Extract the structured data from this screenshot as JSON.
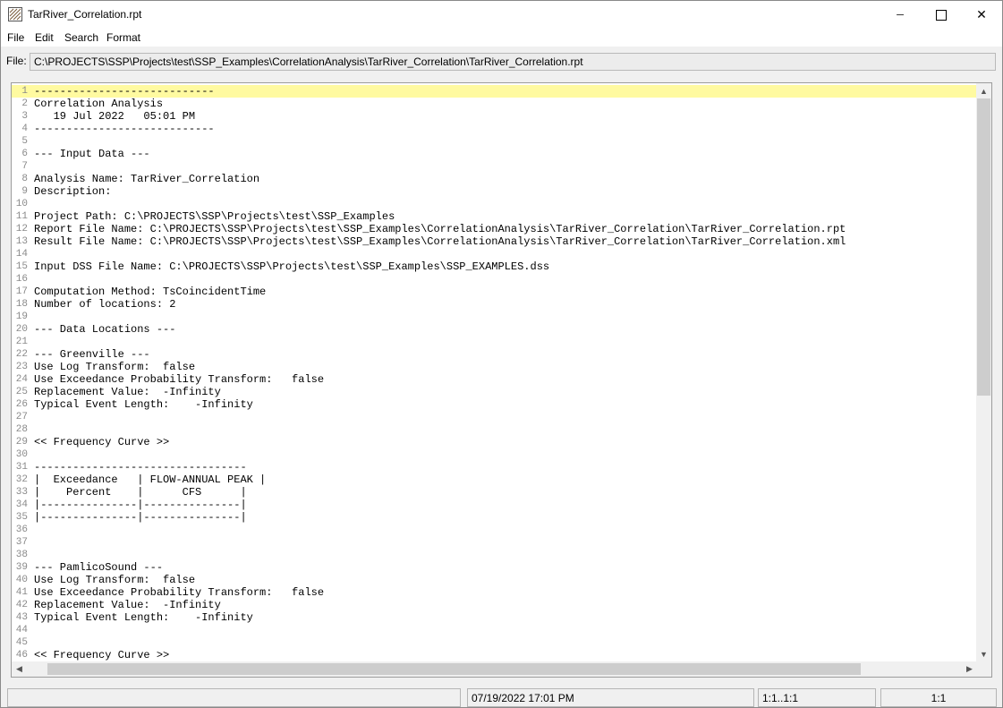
{
  "window": {
    "title": "TarRiver_Correlation.rpt",
    "minimize_glyph": "─",
    "close_glyph": "✕"
  },
  "menu": [
    "File",
    "Edit",
    "Search",
    "Format"
  ],
  "file_bar": {
    "label": "File:",
    "path": "C:\\PROJECTS\\SSP\\Projects\\test\\SSP_Examples\\CorrelationAnalysis\\TarRiver_Correlation\\TarRiver_Correlation.rpt"
  },
  "editor": {
    "highlighted_line": 1,
    "lines": [
      "----------------------------",
      "Correlation Analysis",
      "   19 Jul 2022   05:01 PM",
      "----------------------------",
      "",
      "--- Input Data ---",
      "",
      "Analysis Name: TarRiver_Correlation",
      "Description:",
      "",
      "Project Path: C:\\PROJECTS\\SSP\\Projects\\test\\SSP_Examples",
      "Report File Name: C:\\PROJECTS\\SSP\\Projects\\test\\SSP_Examples\\CorrelationAnalysis\\TarRiver_Correlation\\TarRiver_Correlation.rpt",
      "Result File Name: C:\\PROJECTS\\SSP\\Projects\\test\\SSP_Examples\\CorrelationAnalysis\\TarRiver_Correlation\\TarRiver_Correlation.xml",
      "",
      "Input DSS File Name: C:\\PROJECTS\\SSP\\Projects\\test\\SSP_Examples\\SSP_EXAMPLES.dss",
      "",
      "Computation Method: TsCoincidentTime",
      "Number of locations: 2",
      "",
      "--- Data Locations ---",
      "",
      "--- Greenville ---",
      "Use Log Transform:  false",
      "Use Exceedance Probability Transform:   false",
      "Replacement Value:  -Infinity",
      "Typical Event Length:    -Infinity",
      "",
      "",
      "<< Frequency Curve >>",
      "",
      "---------------------------------",
      "|  Exceedance   | FLOW-ANNUAL PEAK |",
      "|    Percent    |      CFS      |",
      "|---------------|---------------|",
      "|---------------|---------------|",
      "",
      "",
      "",
      "--- PamlicoSound ---",
      "Use Log Transform:  false",
      "Use Exceedance Probability Transform:   false",
      "Replacement Value:  -Infinity",
      "Typical Event Length:    -Infinity",
      "",
      "",
      "<< Frequency Curve >>"
    ]
  },
  "scroll_glyphs": {
    "up": "▲",
    "down": "▼",
    "left": "◀",
    "right": "▶"
  },
  "status_bar": {
    "datetime": "07/19/2022 17:01 PM",
    "selection": "1:1..1:1",
    "position": "1:1"
  }
}
